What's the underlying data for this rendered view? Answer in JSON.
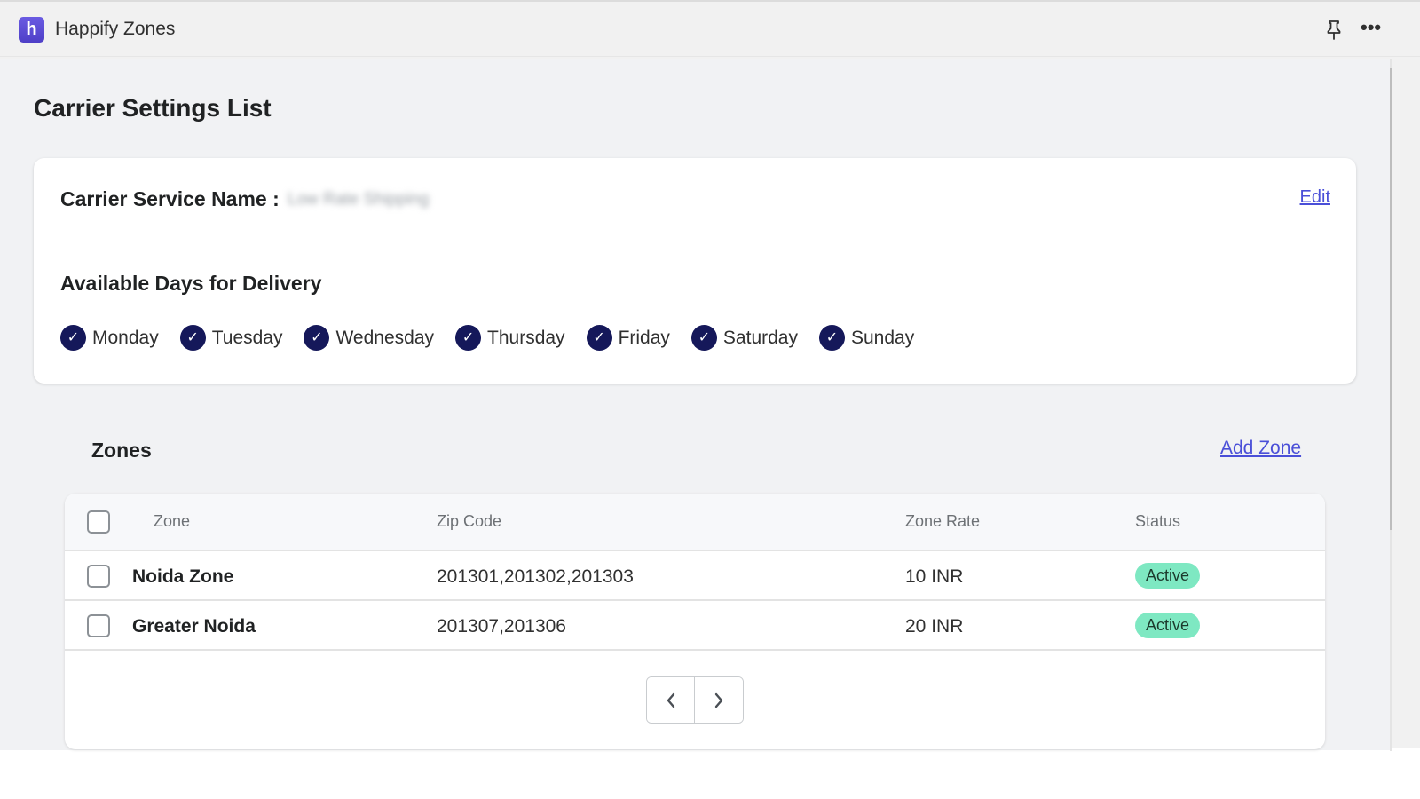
{
  "app": {
    "logo_letter": "h",
    "title": "Happify Zones",
    "brand_color": "#5b4bd6"
  },
  "header_icons": {
    "pin": "pin-icon",
    "more": "more-horizontal-icon",
    "more_glyph": "•••"
  },
  "page": {
    "title": "Carrier Settings List"
  },
  "carrier": {
    "service_name_label": "Carrier Service Name :",
    "service_name_value": "Low Rate Shipping",
    "edit_label": "Edit"
  },
  "delivery": {
    "title": "Available Days for Delivery",
    "check_glyph": "✓",
    "days": [
      {
        "label": "Monday",
        "checked": true
      },
      {
        "label": "Tuesday",
        "checked": true
      },
      {
        "label": "Wednesday",
        "checked": true
      },
      {
        "label": "Thursday",
        "checked": true
      },
      {
        "label": "Friday",
        "checked": true
      },
      {
        "label": "Saturday",
        "checked": true
      },
      {
        "label": "Sunday",
        "checked": true
      }
    ]
  },
  "zones": {
    "title": "Zones",
    "add_label": "Add Zone",
    "columns": [
      "Zone",
      "Zip Code",
      "Zone Rate",
      "Status"
    ],
    "rows": [
      {
        "zone": "Noida Zone",
        "zip": "201301,201302,201303",
        "rate": "10 INR",
        "status": "Active"
      },
      {
        "zone": "Greater Noida",
        "zip": "201307,201306",
        "rate": "20 INR",
        "status": "Active"
      }
    ],
    "status_color": "#7ee8c2"
  },
  "pagination": {
    "prev": "chevron-left-icon",
    "next": "chevron-right-icon"
  }
}
